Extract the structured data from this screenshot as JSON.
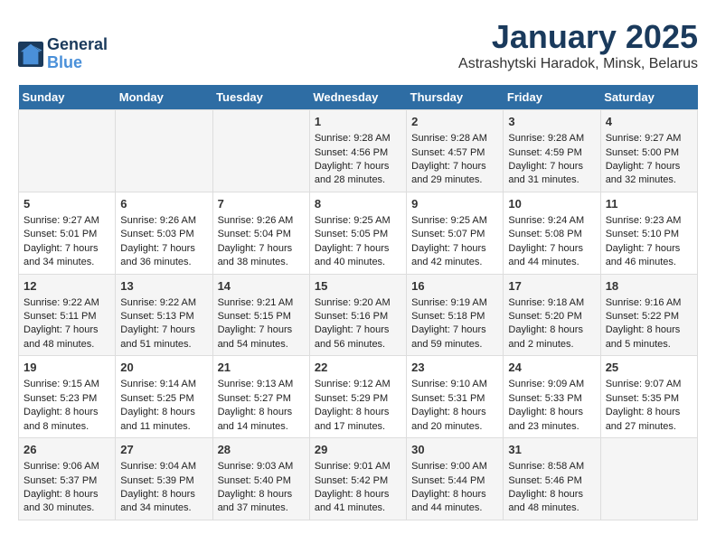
{
  "logo": {
    "text_general": "General",
    "text_blue": "Blue"
  },
  "calendar": {
    "title": "January 2025",
    "subtitle": "Astrashytski Haradok, Minsk, Belarus"
  },
  "weekdays": [
    "Sunday",
    "Monday",
    "Tuesday",
    "Wednesday",
    "Thursday",
    "Friday",
    "Saturday"
  ],
  "weeks": [
    [
      {
        "day": "",
        "content": ""
      },
      {
        "day": "",
        "content": ""
      },
      {
        "day": "",
        "content": ""
      },
      {
        "day": "1",
        "content": "Sunrise: 9:28 AM\nSunset: 4:56 PM\nDaylight: 7 hours\nand 28 minutes."
      },
      {
        "day": "2",
        "content": "Sunrise: 9:28 AM\nSunset: 4:57 PM\nDaylight: 7 hours\nand 29 minutes."
      },
      {
        "day": "3",
        "content": "Sunrise: 9:28 AM\nSunset: 4:59 PM\nDaylight: 7 hours\nand 31 minutes."
      },
      {
        "day": "4",
        "content": "Sunrise: 9:27 AM\nSunset: 5:00 PM\nDaylight: 7 hours\nand 32 minutes."
      }
    ],
    [
      {
        "day": "5",
        "content": "Sunrise: 9:27 AM\nSunset: 5:01 PM\nDaylight: 7 hours\nand 34 minutes."
      },
      {
        "day": "6",
        "content": "Sunrise: 9:26 AM\nSunset: 5:03 PM\nDaylight: 7 hours\nand 36 minutes."
      },
      {
        "day": "7",
        "content": "Sunrise: 9:26 AM\nSunset: 5:04 PM\nDaylight: 7 hours\nand 38 minutes."
      },
      {
        "day": "8",
        "content": "Sunrise: 9:25 AM\nSunset: 5:05 PM\nDaylight: 7 hours\nand 40 minutes."
      },
      {
        "day": "9",
        "content": "Sunrise: 9:25 AM\nSunset: 5:07 PM\nDaylight: 7 hours\nand 42 minutes."
      },
      {
        "day": "10",
        "content": "Sunrise: 9:24 AM\nSunset: 5:08 PM\nDaylight: 7 hours\nand 44 minutes."
      },
      {
        "day": "11",
        "content": "Sunrise: 9:23 AM\nSunset: 5:10 PM\nDaylight: 7 hours\nand 46 minutes."
      }
    ],
    [
      {
        "day": "12",
        "content": "Sunrise: 9:22 AM\nSunset: 5:11 PM\nDaylight: 7 hours\nand 48 minutes."
      },
      {
        "day": "13",
        "content": "Sunrise: 9:22 AM\nSunset: 5:13 PM\nDaylight: 7 hours\nand 51 minutes."
      },
      {
        "day": "14",
        "content": "Sunrise: 9:21 AM\nSunset: 5:15 PM\nDaylight: 7 hours\nand 54 minutes."
      },
      {
        "day": "15",
        "content": "Sunrise: 9:20 AM\nSunset: 5:16 PM\nDaylight: 7 hours\nand 56 minutes."
      },
      {
        "day": "16",
        "content": "Sunrise: 9:19 AM\nSunset: 5:18 PM\nDaylight: 7 hours\nand 59 minutes."
      },
      {
        "day": "17",
        "content": "Sunrise: 9:18 AM\nSunset: 5:20 PM\nDaylight: 8 hours\nand 2 minutes."
      },
      {
        "day": "18",
        "content": "Sunrise: 9:16 AM\nSunset: 5:22 PM\nDaylight: 8 hours\nand 5 minutes."
      }
    ],
    [
      {
        "day": "19",
        "content": "Sunrise: 9:15 AM\nSunset: 5:23 PM\nDaylight: 8 hours\nand 8 minutes."
      },
      {
        "day": "20",
        "content": "Sunrise: 9:14 AM\nSunset: 5:25 PM\nDaylight: 8 hours\nand 11 minutes."
      },
      {
        "day": "21",
        "content": "Sunrise: 9:13 AM\nSunset: 5:27 PM\nDaylight: 8 hours\nand 14 minutes."
      },
      {
        "day": "22",
        "content": "Sunrise: 9:12 AM\nSunset: 5:29 PM\nDaylight: 8 hours\nand 17 minutes."
      },
      {
        "day": "23",
        "content": "Sunrise: 9:10 AM\nSunset: 5:31 PM\nDaylight: 8 hours\nand 20 minutes."
      },
      {
        "day": "24",
        "content": "Sunrise: 9:09 AM\nSunset: 5:33 PM\nDaylight: 8 hours\nand 23 minutes."
      },
      {
        "day": "25",
        "content": "Sunrise: 9:07 AM\nSunset: 5:35 PM\nDaylight: 8 hours\nand 27 minutes."
      }
    ],
    [
      {
        "day": "26",
        "content": "Sunrise: 9:06 AM\nSunset: 5:37 PM\nDaylight: 8 hours\nand 30 minutes."
      },
      {
        "day": "27",
        "content": "Sunrise: 9:04 AM\nSunset: 5:39 PM\nDaylight: 8 hours\nand 34 minutes."
      },
      {
        "day": "28",
        "content": "Sunrise: 9:03 AM\nSunset: 5:40 PM\nDaylight: 8 hours\nand 37 minutes."
      },
      {
        "day": "29",
        "content": "Sunrise: 9:01 AM\nSunset: 5:42 PM\nDaylight: 8 hours\nand 41 minutes."
      },
      {
        "day": "30",
        "content": "Sunrise: 9:00 AM\nSunset: 5:44 PM\nDaylight: 8 hours\nand 44 minutes."
      },
      {
        "day": "31",
        "content": "Sunrise: 8:58 AM\nSunset: 5:46 PM\nDaylight: 8 hours\nand 48 minutes."
      },
      {
        "day": "",
        "content": ""
      }
    ]
  ]
}
